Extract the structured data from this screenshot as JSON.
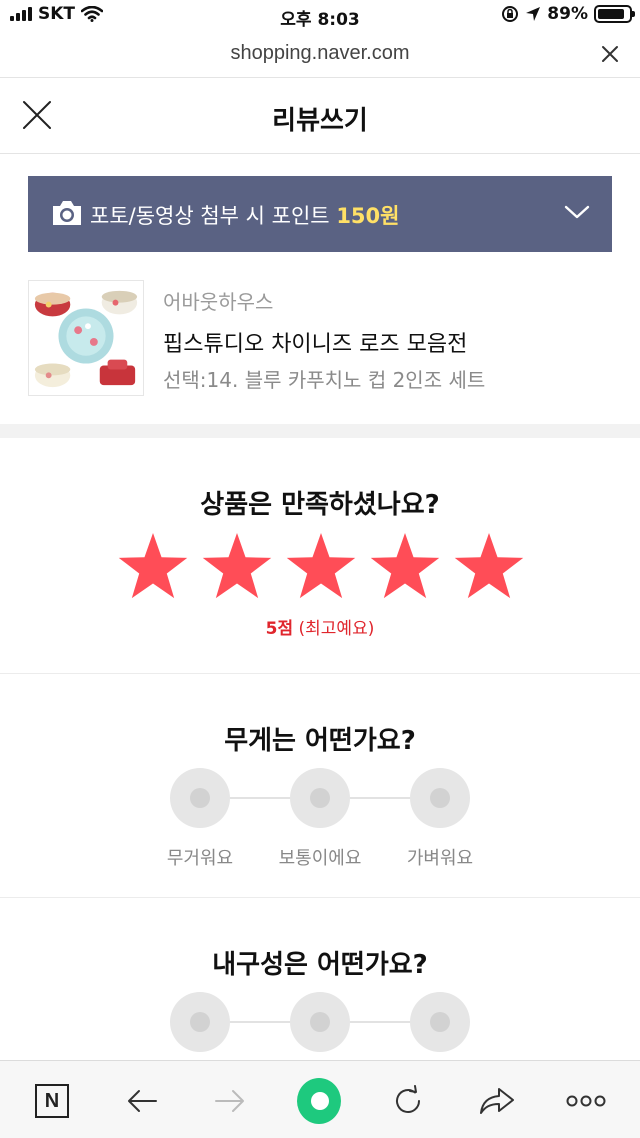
{
  "status_bar": {
    "carrier": "SKT",
    "time": "오후 8:03",
    "battery": "89%"
  },
  "url_bar": {
    "url": "shopping.naver.com"
  },
  "header": {
    "title": "리뷰쓰기"
  },
  "banner": {
    "text": "포토/동영상 첨부 시 포인트",
    "points": "150원"
  },
  "product": {
    "brand": "어바웃하우스",
    "name": "핍스튜디오 차이니즈 로즈 모음전",
    "option": "선택:14. 블루 카푸치노 컵 2인조 세트"
  },
  "rating": {
    "question": "상품은 만족하셨나요?",
    "score_label": "5점",
    "score_desc": "(최고예요)",
    "value": 5,
    "max": 5,
    "star_color": "#ff4d57"
  },
  "weight": {
    "question": "무게는 어떤가요?",
    "options": [
      "무거워요",
      "보통이에요",
      "가벼워요"
    ]
  },
  "durability": {
    "question": "내구성은 어떤가요?"
  },
  "toolbar": {
    "home_logo": "N"
  },
  "colors": {
    "banner_bg": "#5a6283",
    "points_highlight": "#ffe066",
    "accent_red": "#e0262d",
    "naver_green": "#1ec97e"
  }
}
